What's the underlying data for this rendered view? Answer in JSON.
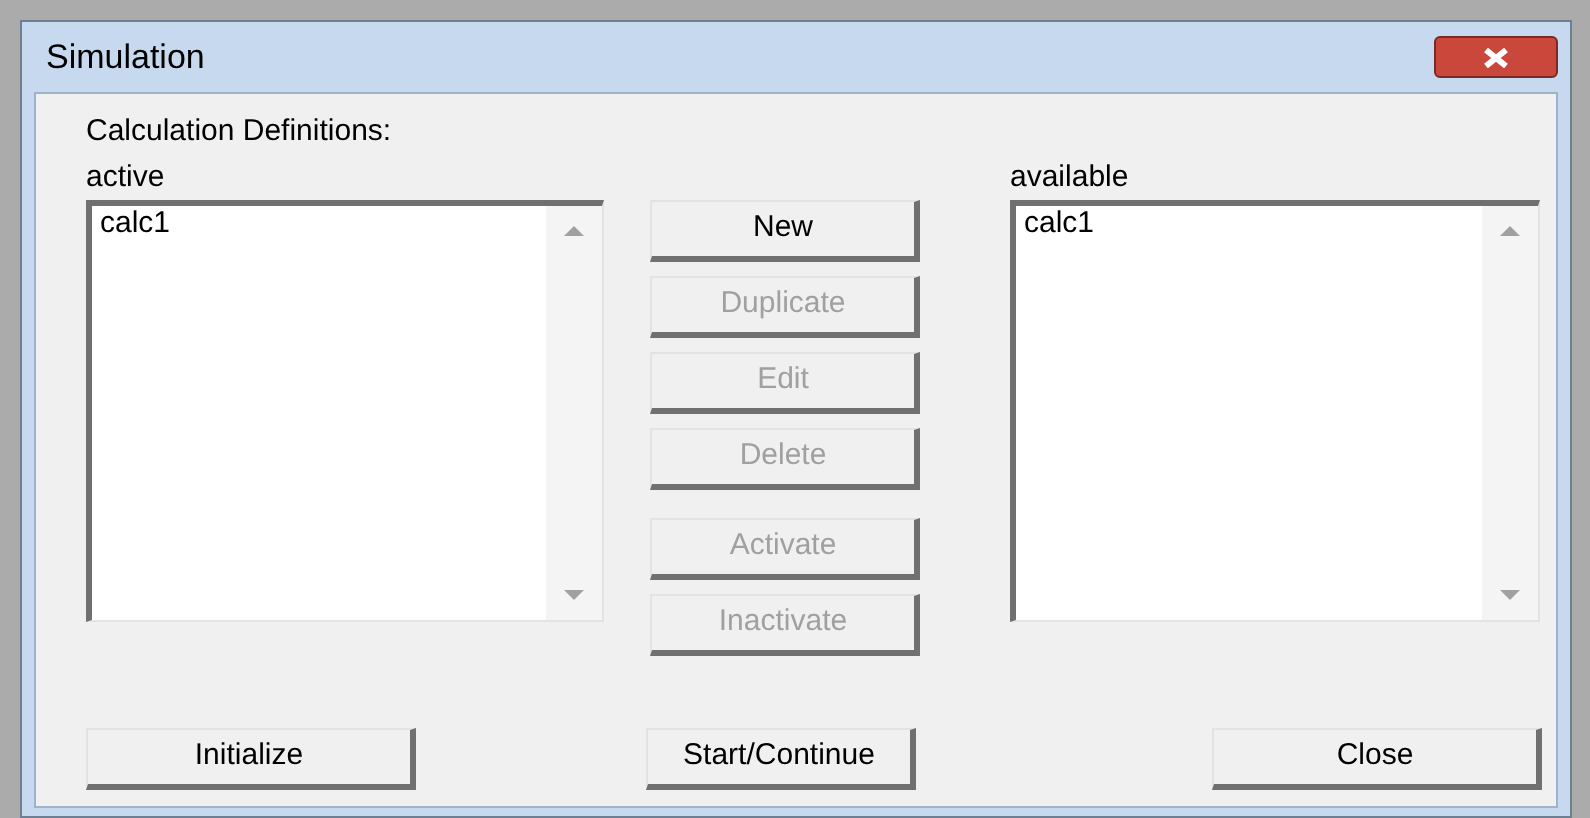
{
  "window": {
    "title": "Simulation"
  },
  "section_label": "Calculation Definitions:",
  "lists": [
    {
      "label": "active",
      "items": [
        "calc1"
      ]
    },
    {
      "label": "available",
      "items": [
        "calc1"
      ]
    }
  ],
  "action_groups": [
    [
      {
        "label": "New",
        "disabled": false
      },
      {
        "label": "Duplicate",
        "disabled": true
      },
      {
        "label": "Edit",
        "disabled": true
      },
      {
        "label": "Delete",
        "disabled": true
      }
    ],
    [
      {
        "label": "Activate",
        "disabled": true
      },
      {
        "label": "Inactivate",
        "disabled": true
      }
    ]
  ],
  "footer_buttons": [
    {
      "label": "Initialize"
    },
    {
      "label": "Start/Continue"
    },
    {
      "label": "Close"
    }
  ]
}
